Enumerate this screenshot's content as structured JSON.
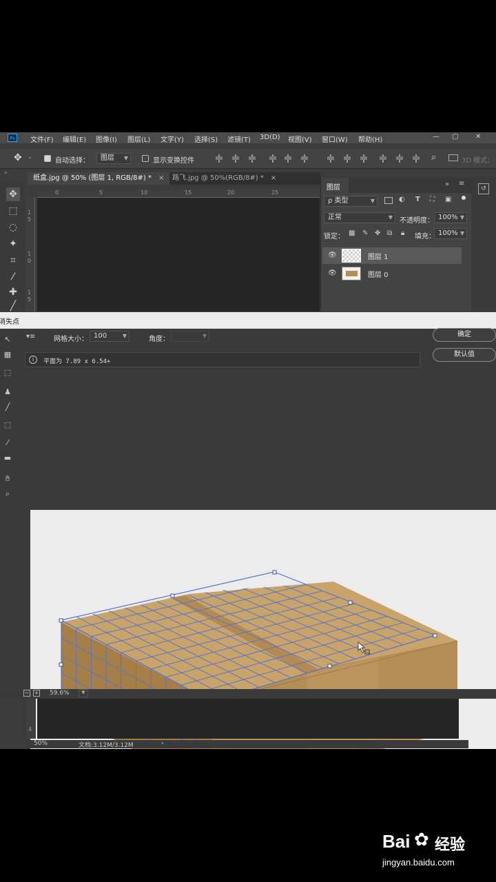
{
  "app": {
    "logo": "Ps",
    "menu": [
      "文件(F)",
      "编辑(E)",
      "图像(I)",
      "图层(L)",
      "文字(Y)",
      "选择(S)",
      "滤镜(T)",
      "3D(D)",
      "视图(V)",
      "窗口(W)",
      "帮助(H)"
    ]
  },
  "options_bar": {
    "auto_select_label": "自动选择：",
    "auto_select_value": "图层",
    "show_transform_label": "显示变换控件",
    "mode_3d_label": "3D 模式："
  },
  "tabs": [
    {
      "label": "纸盒.jpg @ 50% (图层 1, RGB/8#) *",
      "close": "×"
    },
    {
      "label": "路飞.jpg @ 50%(RGB/8#) *",
      "close": "×"
    }
  ],
  "ruler": {
    "top_ticks": [
      "0",
      "5",
      "10",
      "15",
      "20",
      "25"
    ],
    "left_ticks": [
      "1",
      "5",
      "1",
      "0",
      "1",
      "5"
    ]
  },
  "layers_panel": {
    "title": "图层",
    "filter_label": "ρ 类型",
    "blend_mode": "正常",
    "opacity_label": "不透明度：",
    "opacity_value": "100%",
    "lock_label": "锁定：",
    "fill_label": "填充：",
    "fill_value": "100%",
    "layers": [
      {
        "name": "图层 1",
        "selected": true
      },
      {
        "name": "图层 0",
        "selected": false
      }
    ]
  },
  "vanishing_point": {
    "title": "消失点",
    "grid_size_label": "网格大小：",
    "grid_size_value": "100",
    "angle_label": "角度：",
    "info_text": "平面为 7.89 x 6.54+",
    "ok_label": "确定",
    "reset_label": "默认值",
    "zoom_value": "59.6%"
  },
  "status": {
    "zoom": "50%",
    "doc_info": "文档:3.12M/3.12M",
    "arrow": "›"
  },
  "watermark": {
    "brand": "Bai",
    "brand2": "du",
    "product": "经验",
    "url": "jingyan.baidu.com"
  },
  "colors": {
    "ps_bg": "#3c3c3c",
    "accent": "#31a8ff",
    "grid_line": "#5a73c8",
    "box_top": "#c9a46a",
    "box_front": "#b48d57"
  }
}
